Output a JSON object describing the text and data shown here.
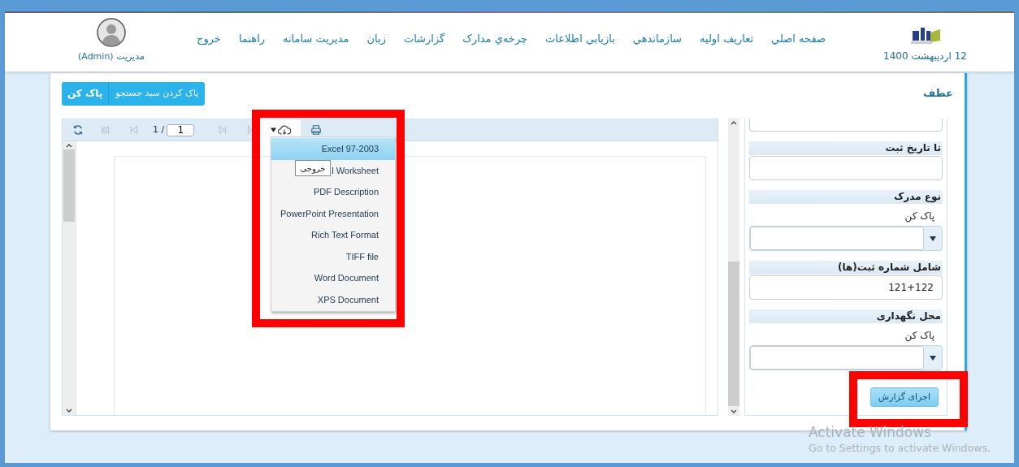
{
  "header": {
    "date": "12 اردیبهشت 1400",
    "nav": [
      "صفحه اصلي",
      "تعاريف اوليه",
      "سازماندهي",
      "بازيابي اطلاعات",
      "چرخه‌ي مدارک",
      "گزارشات",
      "زبان",
      "مديريت سامانه",
      "راهنما",
      "خروج"
    ],
    "user": "مديريت (Admin)"
  },
  "page": {
    "title": "عطف",
    "buttons": [
      "پاک کردن سبد جستجو",
      "پاک کن"
    ]
  },
  "viewer": {
    "nav_buttons": [
      {
        "kind": "first",
        "disabled": true
      },
      {
        "kind": "prev",
        "disabled": true
      },
      {
        "kind": "next",
        "disabled": true
      },
      {
        "kind": "last",
        "disabled": true
      }
    ],
    "page_label": "1 /",
    "page_input": "1",
    "tooltip": "خروجی",
    "export_menu": [
      {
        "label": "Excel 97-2003",
        "selected": true
      },
      {
        "label": "l Worksheet",
        "selected": false
      },
      {
        "label": "PDF Description",
        "selected": false
      },
      {
        "label": "PowerPoint Presentation",
        "selected": false
      },
      {
        "label": "Rich Text Format",
        "selected": false
      },
      {
        "label": "TIFF file",
        "selected": false
      },
      {
        "label": "Word Document",
        "selected": false
      },
      {
        "label": "XPS Document",
        "selected": false
      }
    ]
  },
  "filters": [
    {
      "kind": "text",
      "partial": true
    },
    {
      "kind": "text",
      "label": "تا تاریخ ثبت"
    },
    {
      "kind": "select",
      "label": "نوع مدرک",
      "clear": "پاک کن"
    },
    {
      "kind": "text",
      "label": "شامل شماره ثبت(ها)",
      "value": "121+122"
    },
    {
      "kind": "select",
      "label": "محل نگهداری",
      "clear": "پاک کن"
    }
  ],
  "run_button": "اجرای گزارش",
  "os_notice": [
    "Activate Windows",
    "Go to Settings to activate Windows."
  ]
}
